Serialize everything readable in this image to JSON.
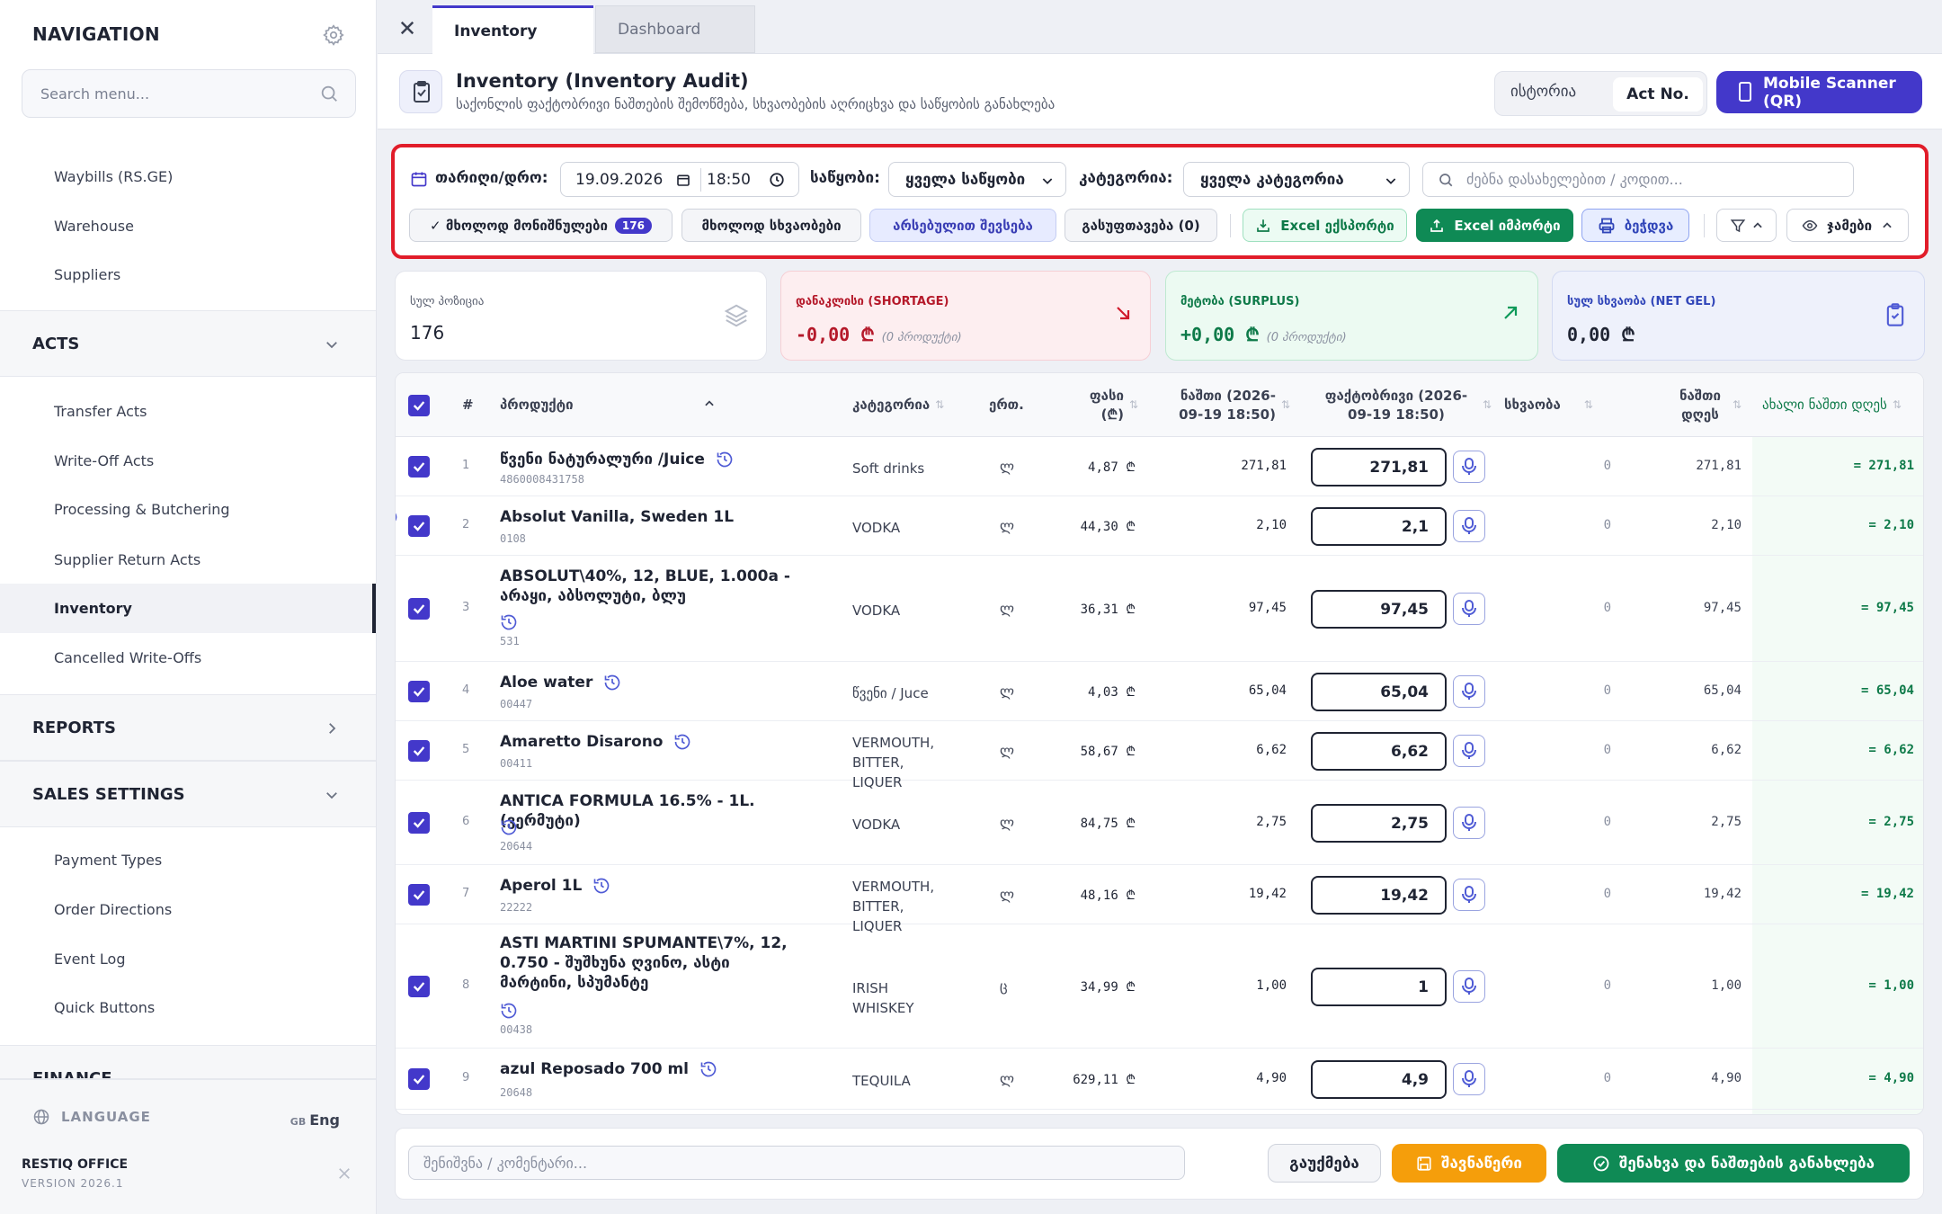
{
  "sidebar": {
    "title": "NAVIGATION",
    "search_placeholder": "Search menu...",
    "items_top": [
      {
        "label": "Waybills (RS.GE)"
      },
      {
        "label": "Warehouse"
      },
      {
        "label": "Suppliers"
      }
    ],
    "acts_section": "ACTS",
    "acts_items": [
      {
        "label": "Transfer Acts"
      },
      {
        "label": "Write-Off Acts"
      },
      {
        "label": "Processing & Butchering"
      },
      {
        "label": "Supplier Return Acts"
      },
      {
        "label": "Inventory",
        "active": true
      },
      {
        "label": "Cancelled Write-Offs"
      }
    ],
    "reports_section": "REPORTS",
    "sales_section": "SALES SETTINGS",
    "sales_items": [
      {
        "label": "Payment Types"
      },
      {
        "label": "Order Directions"
      },
      {
        "label": "Event Log"
      },
      {
        "label": "Quick Buttons"
      }
    ],
    "finance_section": "FINANCE",
    "language_label": "LANGUAGE",
    "language_flag": "GB",
    "language_value": "Eng",
    "brand": "RESTIQ OFFICE",
    "version": "VERSION 2026.1"
  },
  "tabs": [
    {
      "label": "Inventory",
      "active": true
    },
    {
      "label": "Dashboard",
      "active": false
    }
  ],
  "header": {
    "title": "Inventory (Inventory Audit)",
    "subtitle": "საქონლის ფაქტობრივი ნაშთების შემოწმება, სხვაობების აღრიცხვა და საწყობის განახლება",
    "seg_history": "ისტორია",
    "seg_act": "Act No.",
    "scanner_button": "Mobile Scanner (QR)"
  },
  "filters": {
    "date_label": "თარიღი/დრო:",
    "date_value": "19.09.2026",
    "time_value": "18:50",
    "warehouse_label": "საწყობი:",
    "warehouse_value": "ყველა საწყობი",
    "category_label": "კატეგორია:",
    "category_value": "ყველა კატეგორია",
    "search_placeholder": "ძებნა დასახელებით / კოდით...",
    "chip_selected": "✓ მხოლოდ მონიშნულები",
    "chip_selected_count": "176",
    "chip_diff": "მხოლოდ სხვაობები",
    "chip_actual_fill": "არსებულით შევსება",
    "chip_clear": "გასუფთავება (0)",
    "excel_export": "Excel ექსპორტი",
    "excel_import": "Excel იმპორტი",
    "print": "ბეჭდვა",
    "totals": "ჯამები"
  },
  "stats": {
    "positions_label": "სულ პოზიცია",
    "positions_value": "176",
    "shortage_label": "დანაკლისი (SHORTAGE)",
    "shortage_value": "-0,00 ₾",
    "shortage_note": "(0 პროდუქტი)",
    "surplus_label": "მეტობა (SURPLUS)",
    "surplus_value": "+0,00 ₾",
    "surplus_note": "(0 პროდუქტი)",
    "net_label": "სულ სხვაობა (NET GEL)",
    "net_value": "0,00 ₾"
  },
  "table": {
    "headers": {
      "num": "#",
      "product": "პროდუქტი",
      "category": "კატეგორია",
      "unit": "ერთ.",
      "price": "ფასი (₾)",
      "balance": "ნაშთი (2026-09-19 18:50)",
      "actual": "ფაქტობრივი (2026-09-19 18:50)",
      "diff": "სხვაობა",
      "balance_today": "ნაშთი დღეს",
      "new_balance": "ახალი ნაშთი დღეს"
    },
    "rows": [
      {
        "num": "1",
        "name": "წვენი ნატურალური /Juice",
        "code": "4860008431758",
        "category": "Soft drinks",
        "unit": "ლ",
        "price": "4,87 ₾",
        "balance": "271,81",
        "actual": "271,81",
        "diff": "0",
        "today": "271,81",
        "new": "= 271,81"
      },
      {
        "num": "2",
        "name": "Absolut Vanilla, Sweden 1L",
        "code": "0108",
        "category": "VODKA",
        "unit": "ლ",
        "price": "44,30 ₾",
        "balance": "2,10",
        "actual": "2,1",
        "diff": "0",
        "today": "2,10",
        "new": "= 2,10"
      },
      {
        "num": "3",
        "name": "ABSOLUT\\40%, 12, BLUE, 1.000a - არაყი, აბსოლუტი, ბლუ",
        "code": "531",
        "category": "VODKA",
        "unit": "ლ",
        "price": "36,31 ₾",
        "balance": "97,45",
        "actual": "97,45",
        "diff": "0",
        "today": "97,45",
        "new": "= 97,45"
      },
      {
        "num": "4",
        "name": "Aloe water",
        "code": "00447",
        "category": "წვენი / Juce",
        "unit": "ლ",
        "price": "4,03 ₾",
        "balance": "65,04",
        "actual": "65,04",
        "diff": "0",
        "today": "65,04",
        "new": "= 65,04"
      },
      {
        "num": "5",
        "name": "Amaretto Disarono",
        "code": "00411",
        "category": "VERMOUTH, BITTER, LIQUER",
        "unit": "ლ",
        "price": "58,67 ₾",
        "balance": "6,62",
        "actual": "6,62",
        "diff": "0",
        "today": "6,62",
        "new": "= 6,62"
      },
      {
        "num": "6",
        "name": "ANTICA FORMULA 16.5% - 1L. (ვერმუტი)",
        "code": "20644",
        "category": "VODKA",
        "unit": "ლ",
        "price": "84,75 ₾",
        "balance": "2,75",
        "actual": "2,75",
        "diff": "0",
        "today": "2,75",
        "new": "= 2,75"
      },
      {
        "num": "7",
        "name": "Aperol 1L",
        "code": "22222",
        "category": "VERMOUTH, BITTER, LIQUER",
        "unit": "ლ",
        "price": "48,16 ₾",
        "balance": "19,42",
        "actual": "19,42",
        "diff": "0",
        "today": "19,42",
        "new": "= 19,42"
      },
      {
        "num": "8",
        "name": "ASTI MARTINI SPUMANTE\\7%, 12, 0.750 - შუშხუნა ღვინო, ასტი მარტინი, სპუმანტე",
        "code": "00438",
        "category": "IRISH WHISKEY",
        "unit": "ც",
        "price": "34,99 ₾",
        "balance": "1,00",
        "actual": "1",
        "diff": "0",
        "today": "1,00",
        "new": "= 1,00"
      },
      {
        "num": "9",
        "name": "azul Reposado 700 ml",
        "code": "20648",
        "category": "TEQUILA",
        "unit": "ლ",
        "price": "629,11 ₾",
        "balance": "4,90",
        "actual": "4,9",
        "diff": "0",
        "today": "4,90",
        "new": "= 4,90"
      }
    ]
  },
  "footer": {
    "note_placeholder": "შენიშვნა / კომენტარი...",
    "cancel": "გაუქმება",
    "draft": "შავნაწერი",
    "save": "შენახვა და ნაშთების განახლება"
  }
}
